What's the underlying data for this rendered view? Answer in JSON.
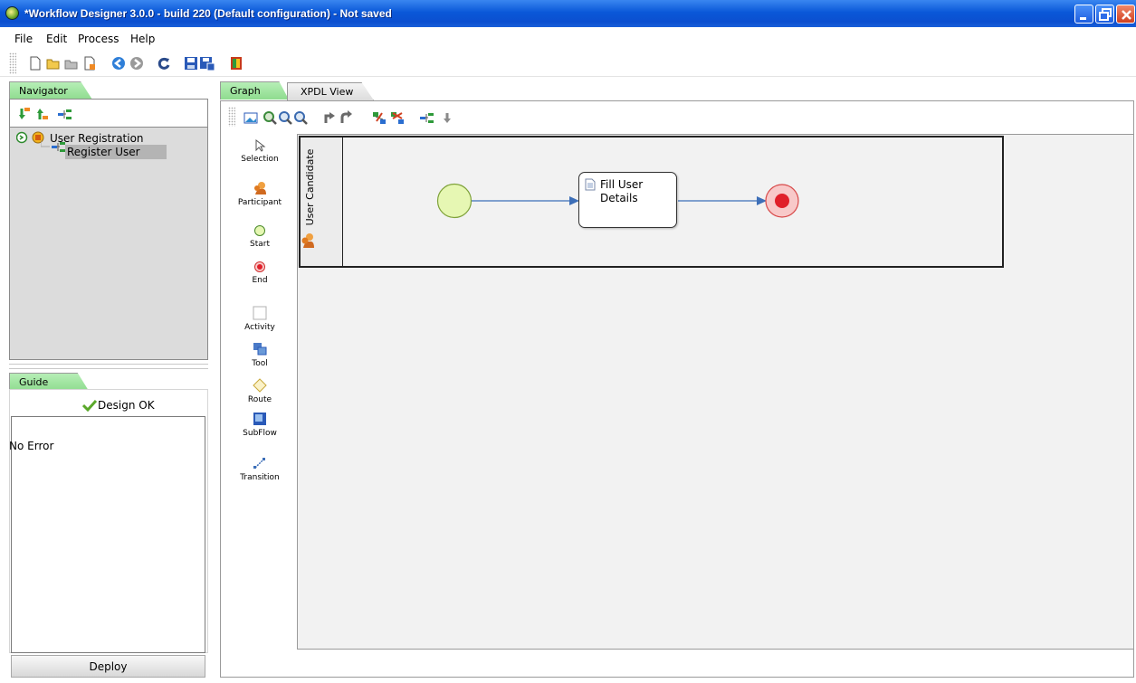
{
  "window": {
    "title": "*Workflow Designer 3.0.0 - build 220 (Default configuration) - Not saved",
    "icon": "workflow-app-icon"
  },
  "menu": {
    "items": [
      {
        "label": "File"
      },
      {
        "label": "Edit"
      },
      {
        "label": "Process"
      },
      {
        "label": "Help"
      }
    ]
  },
  "toolbar": {
    "icons": [
      "new-icon",
      "open-icon",
      "close-icon",
      "properties-icon",
      "back-icon",
      "forward-icon",
      "refresh-icon",
      "save-icon",
      "save-as-icon",
      "exit-icon"
    ]
  },
  "navigator": {
    "tab_label": "Navigator",
    "tree": [
      {
        "label": "User Registration",
        "icon": "package-icon",
        "level": 0
      },
      {
        "label": "Register User",
        "icon": "process-icon",
        "level": 1,
        "selected": true
      }
    ]
  },
  "guide": {
    "tab_label": "Guide",
    "status": "Design OK",
    "message": "No Error",
    "deploy_label": "Deploy"
  },
  "editor": {
    "tabs": [
      {
        "label": "Graph",
        "active": true
      },
      {
        "label": "XPDL View",
        "active": false
      }
    ]
  },
  "palette": {
    "items": [
      {
        "label": "Selection",
        "icon": "selection-arrow-icon"
      },
      {
        "label": "Participant",
        "icon": "participant-icon"
      },
      {
        "label": "Start",
        "icon": "start-circle-icon"
      },
      {
        "label": "End",
        "icon": "end-circle-icon"
      },
      {
        "label": "Activity",
        "icon": "activity-icon"
      },
      {
        "label": "Tool",
        "icon": "tool-icon"
      },
      {
        "label": "Route",
        "icon": "route-diamond-icon"
      },
      {
        "label": "SubFlow",
        "icon": "subflow-icon"
      },
      {
        "label": "Transition",
        "icon": "transition-icon"
      }
    ]
  },
  "diagram": {
    "lane_label": "User Candidate",
    "activity_label": "Fill User Details",
    "colors": {
      "start_fill": "#e6f7b3",
      "start_stroke": "#7fa23a",
      "end_fill": "#f8c9c9",
      "end_inner": "#e0202a",
      "transition": "#3d6fb8",
      "canvas": "#f2f2f2"
    }
  }
}
